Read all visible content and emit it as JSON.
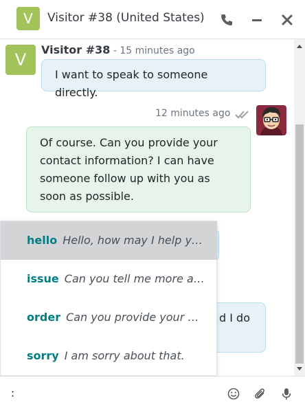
{
  "header": {
    "avatar_letter": "V",
    "title": "Visitor #38 (United States)"
  },
  "thread": {
    "visitor_message": {
      "avatar_letter": "V",
      "author": "Visitor #38",
      "separator": " - ",
      "time": "15 minutes ago",
      "text": "I want to speak to someone directly."
    },
    "agent_message": {
      "time": "12 minutes ago",
      "text": "Of course. Can you provide your contact information? I can have someone follow up with you as soon as possible."
    },
    "partial_message": {
      "text": "d I do"
    }
  },
  "canned_responses": [
    {
      "key": "hello",
      "value": "Hello, how may I help y…"
    },
    {
      "key": "issue",
      "value": "Can you tell me more a…"
    },
    {
      "key": "order",
      "value": "Can you provide your …"
    },
    {
      "key": "sorry",
      "value": "I am sorry about that."
    }
  ],
  "composer": {
    "value": ":"
  },
  "colors": {
    "avatar_bg": "#a2c25a",
    "visitor_bubble": "#e6f2f7",
    "agent_bubble": "#e7f4e9",
    "canned_key": "#017e84",
    "active_row": "#d3d4d6"
  }
}
